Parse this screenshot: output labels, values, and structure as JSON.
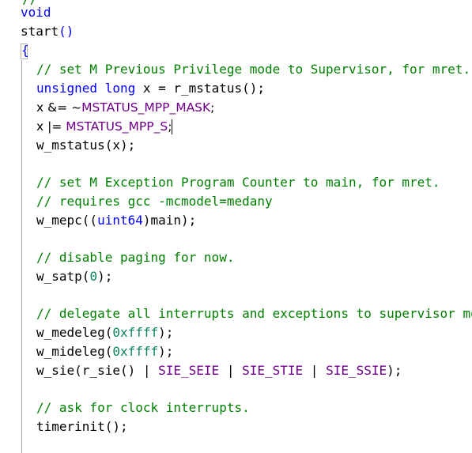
{
  "editor": {
    "top_partial": "//   ...  ...",
    "lines": {
      "void": "void",
      "start_func": "start",
      "start_parens": "()",
      "open_brace": "{",
      "c1": "// set M Previous Privilege mode to Supervisor, for mret.",
      "l2_kw": "unsigned long",
      "l2_rest": " x = r_mstatus();",
      "l3_prefix": "x &= ~",
      "l3_mac": "MSTATUS_MPP_MASK",
      "l3_suffix": ";",
      "l4_prefix": "x |= ",
      "l4_mac": "MSTATUS_MPP_S",
      "l4_suffix": ";",
      "l5": "w_mstatus(x);",
      "c2": "// set M Exception Program Counter to main, for mret.",
      "c3": "// requires gcc -mcmodel=medany",
      "l8_prefix": "w_mepc((",
      "l8_kw": "uint64",
      "l8_suffix": ")main);",
      "c4": "// disable paging for now.",
      "l10_prefix": "w_satp(",
      "l10_num": "0",
      "l10_suffix": ");",
      "c5": "// delegate all interrupts and exceptions to supervisor mo",
      "l12_prefix": "w_medeleg(",
      "l12_num": "0xffff",
      "l12_suffix": ");",
      "l13_prefix": "w_mideleg(",
      "l13_num": "0xffff",
      "l13_suffix": ");",
      "l14_prefix": "w_sie(r_sie() | ",
      "l14_mac1": "SIE_SEIE",
      "l14_sep1": " | ",
      "l14_mac2": "SIE_STIE",
      "l14_sep2": " | ",
      "l14_mac3": "SIE_SSIE",
      "l14_suffix": ");",
      "c6": "// ask for clock interrupts.",
      "l16": "timerinit();"
    }
  },
  "colors": {
    "keyword": "#0000ff",
    "comment": "#008000",
    "macro": "#6f008a",
    "number": "#098658"
  }
}
